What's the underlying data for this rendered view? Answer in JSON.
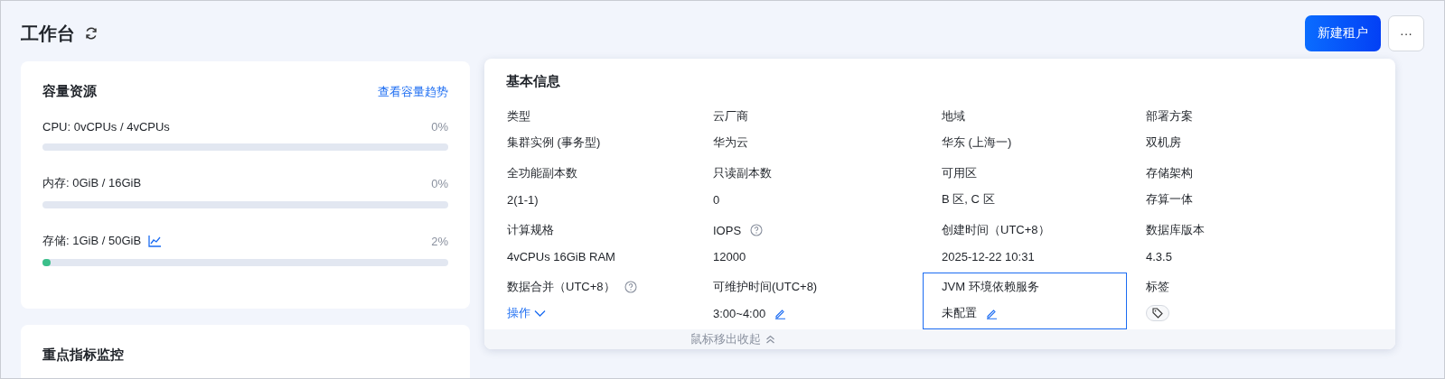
{
  "header": {
    "title": "工作台",
    "buttons": [
      {
        "label": "新建租户",
        "kind": "primary"
      },
      {
        "label": "···",
        "kind": "more"
      }
    ]
  },
  "capacity": {
    "title": "容量资源",
    "link": "查看容量趋势",
    "items": [
      {
        "label": "CPU: 0vCPUs / 4vCPUs",
        "percent": "0%",
        "level": 0,
        "trend_icon": false
      },
      {
        "label": "内存: 0GiB / 16GiB",
        "percent": "0%",
        "level": 0,
        "trend_icon": false
      },
      {
        "label": "存储: 1GiB / 50GiB",
        "percent": "2%",
        "level": 0.02,
        "trend_icon": true
      }
    ]
  },
  "monitor": {
    "title": "重点指标监控"
  },
  "info": {
    "title": "基本信息",
    "fields": [
      {
        "label": "类型",
        "value": "集群实例 (事务型)",
        "kind": "text",
        "help": false,
        "selected": false
      },
      {
        "label": "云厂商",
        "value": "华为云",
        "kind": "text",
        "help": false,
        "selected": false
      },
      {
        "label": "地域",
        "value": "华东 (上海一)",
        "kind": "text",
        "help": false,
        "selected": false
      },
      {
        "label": "部署方案",
        "value": "双机房",
        "kind": "text",
        "help": false,
        "selected": false
      },
      {
        "label": "全功能副本数",
        "value": "2(1-1)",
        "kind": "text",
        "help": false,
        "selected": false
      },
      {
        "label": "只读副本数",
        "value": "0",
        "kind": "text",
        "help": false,
        "selected": false
      },
      {
        "label": "可用区",
        "value": "B 区, C 区",
        "kind": "text",
        "help": false,
        "selected": false
      },
      {
        "label": "存储架构",
        "value": "存算一体",
        "kind": "text",
        "help": false,
        "selected": false
      },
      {
        "label": "计算规格",
        "value": "4vCPUs 16GiB RAM",
        "kind": "text",
        "help": false,
        "selected": false
      },
      {
        "label": "IOPS",
        "value": "12000",
        "kind": "text",
        "help": true,
        "selected": false
      },
      {
        "label": "创建时间（UTC+8）",
        "value": "2025-12-22 10:31",
        "kind": "text",
        "help": false,
        "selected": false
      },
      {
        "label": "数据库版本",
        "value": "4.3.5",
        "kind": "text",
        "help": false,
        "selected": false
      },
      {
        "label": "数据合并（UTC+8）",
        "value": "操作",
        "kind": "action",
        "help": true,
        "selected": false
      },
      {
        "label": "可维护时间(UTC+8)",
        "value": "3:00~4:00",
        "kind": "editable",
        "help": false,
        "selected": false
      },
      {
        "label": "JVM 环境依赖服务",
        "value": "未配置",
        "kind": "editable",
        "help": false,
        "selected": true
      },
      {
        "label": "标签",
        "kind": "tag",
        "help": false,
        "selected": false
      }
    ],
    "collapse": "鼠标移出收起"
  }
}
